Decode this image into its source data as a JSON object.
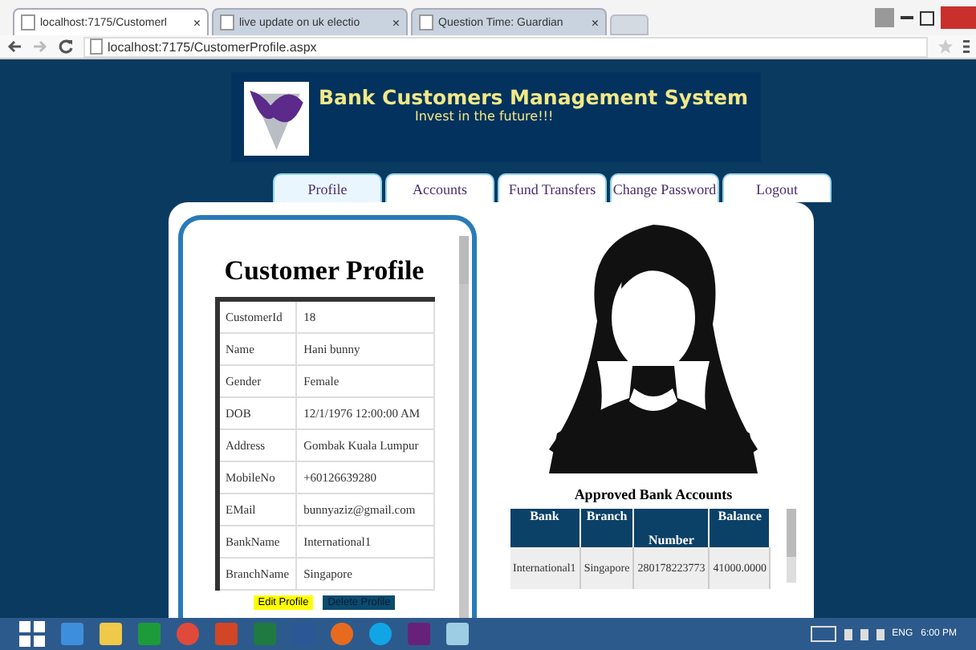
{
  "browser": {
    "tabs": [
      {
        "label": "localhost:7175/Customerl",
        "selected": true
      },
      {
        "label": "live update on uk electio",
        "selected": false
      },
      {
        "label": "Question Time: Guardian",
        "selected": false
      }
    ],
    "close_glyph": "×",
    "address": "localhost:7175/CustomerProfile.aspx"
  },
  "banner": {
    "title": "Bank Customers Management System",
    "tagline": "Invest in the future!!!"
  },
  "nav": [
    {
      "label": "Profile",
      "selected": true
    },
    {
      "label": "Accounts",
      "selected": false
    },
    {
      "label": "Fund Transfers",
      "selected": false
    },
    {
      "label": "Change Password",
      "selected": false
    },
    {
      "label": "Logout",
      "selected": false
    }
  ],
  "profile": {
    "heading": "Customer Profile",
    "fields": [
      {
        "label": "CustomerId",
        "value": "18"
      },
      {
        "label": "Name",
        "value": "Hani bunny"
      },
      {
        "label": "Gender",
        "value": "Female"
      },
      {
        "label": "DOB",
        "value": "12/1/1976 12:00:00 AM"
      },
      {
        "label": "Address",
        "value": "Gombak Kuala Lumpur"
      },
      {
        "label": "MobileNo",
        "value": "+60126639280"
      },
      {
        "label": "EMail",
        "value": "bunnyaziz@gmail.com"
      },
      {
        "label": "BankName",
        "value": "International1"
      },
      {
        "label": "BranchName",
        "value": "Singapore"
      }
    ],
    "buttons": [
      {
        "label": "Edit Profile",
        "kind": "edit"
      },
      {
        "label": "Delete Profile",
        "kind": "delete"
      }
    ]
  },
  "accounts": {
    "heading": "Approved Bank Accounts",
    "columns": [
      "Bank",
      "Branch",
      "Number",
      "Balance"
    ],
    "rows": [
      [
        "International1",
        "Singapore",
        "280178223773",
        "41000.0000"
      ]
    ]
  },
  "taskbar": {
    "tray_language": "ENG",
    "time": "6:00 PM"
  }
}
